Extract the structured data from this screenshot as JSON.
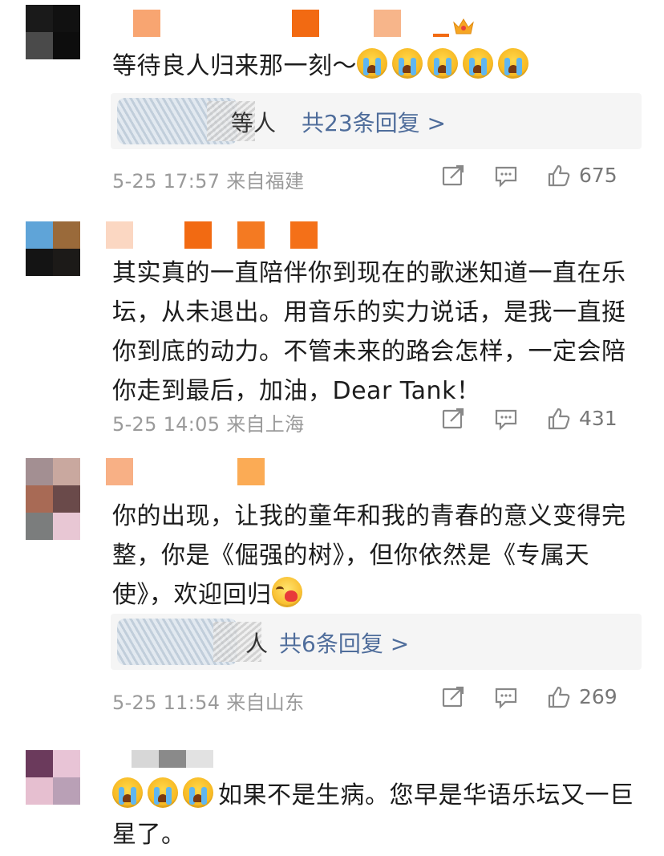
{
  "comments": [
    {
      "text": "等待良人归来那一刻～",
      "emoji_after": [
        "crying-face",
        "crying-face",
        "crying-face",
        "crying-face",
        "crying-face"
      ],
      "replies": {
        "suffix": "等人",
        "link": "共23条回复 >"
      },
      "meta": "5-25 17:57  来自福建",
      "likes": "675"
    },
    {
      "text": "其实真的一直陪伴你到现在的歌迷知道一直在乐坛，从未退出。用音乐的实力说话，是我一直挺你到底的动力。不管未来的路会怎样，一定会陪你走到最后，加油，Dear Tank！",
      "meta": "5-25 14:05  来自上海",
      "likes": "431"
    },
    {
      "text": "你的出现，让我的童年和我的青春的意义变得完整，你是《倔强的树》，但你依然是《专属天使》，欢迎回归",
      "emoji_after": [
        "kiss-face"
      ],
      "replies": {
        "suffix": "人",
        "link": "共6条回复 >"
      },
      "meta": "5-25 11:54  来自山东",
      "likes": "269"
    },
    {
      "emoji_before": [
        "crying-face",
        "crying-face",
        "crying-face"
      ],
      "text": "如果不是生病。您早是华语乐坛又一巨星了。"
    }
  ],
  "icons": {
    "repost": "repost-icon",
    "comment": "comment-icon",
    "like": "thumbs-up-icon",
    "badge": "crown-icon"
  },
  "colors": {
    "link": "#4f6d9b",
    "meta": "#9a9a9a",
    "reply_bg": "#f5f5f5"
  }
}
